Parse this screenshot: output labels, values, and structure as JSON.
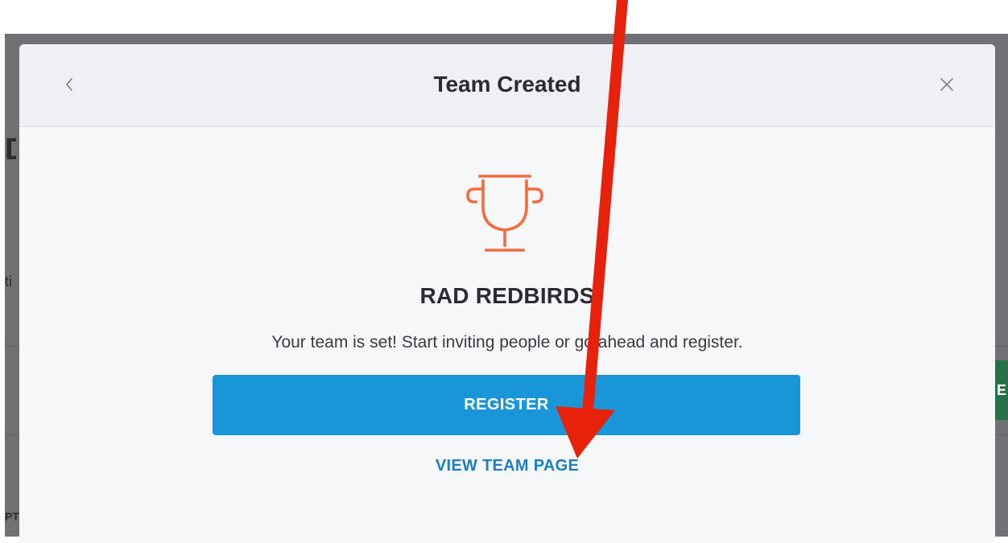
{
  "modal": {
    "title": "Team Created",
    "back_icon": "chevron-left-icon",
    "close_icon": "close-icon"
  },
  "team": {
    "icon": "trophy-icon",
    "name": "RAD REDBIRDS",
    "message": "Your team is set! Start inviting people or go ahead and register."
  },
  "actions": {
    "register_label": "REGISTER",
    "view_team_label": "VIEW TEAM PAGE"
  },
  "annotation": {
    "icon": "red-arrow-annotation"
  },
  "background": {
    "fragment_1": "D",
    "fragment_2": "ti",
    "fragment_3": "PT",
    "fragment_4": "E"
  },
  "colors": {
    "primary_button": "#1896d8",
    "link": "#1b7fc0",
    "trophy": "#f26d3d",
    "annotation_arrow": "#e8210d",
    "overlay": "#6f7175"
  }
}
